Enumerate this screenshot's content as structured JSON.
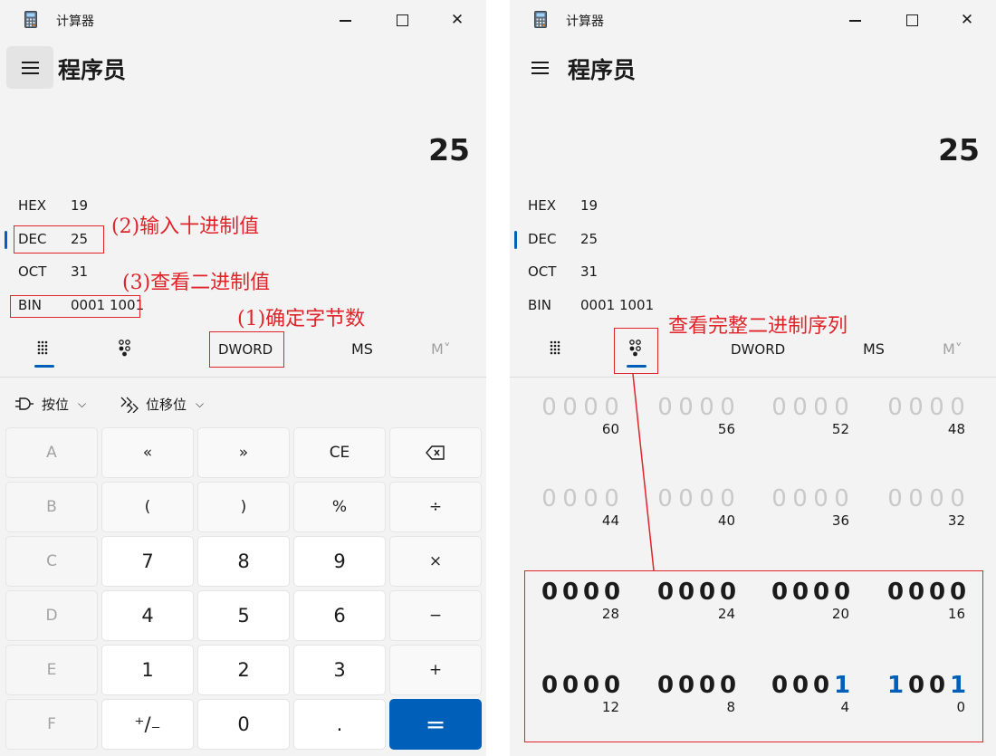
{
  "app": {
    "title": "计算器",
    "mode": "程序员",
    "display": "25",
    "radix": [
      {
        "label": "HEX",
        "value": "19"
      },
      {
        "label": "DEC",
        "value": "25"
      },
      {
        "label": "OCT",
        "value": "31"
      },
      {
        "label": "BIN",
        "value": "0001 1001"
      }
    ],
    "toolbar": {
      "word_size": "DWORD",
      "ms": "MS",
      "mr": "M˅"
    },
    "bitwise": {
      "bit_ops": "按位",
      "bit_shift": "位移位"
    },
    "keypad": [
      [
        "A",
        "«",
        "»",
        "CE",
        "backspace"
      ],
      [
        "B",
        "(",
        ")",
        "%",
        "÷"
      ],
      [
        "C",
        "7",
        "8",
        "9",
        "×"
      ],
      [
        "D",
        "4",
        "5",
        "6",
        "−"
      ],
      [
        "E",
        "1",
        "2",
        "3",
        "+"
      ],
      [
        "F",
        "⁺/₋",
        "0",
        ".",
        "="
      ]
    ],
    "bit_rows": [
      {
        "bits": [
          "0000",
          "0000",
          "0000",
          "0000"
        ],
        "positions": [
          "60",
          "56",
          "52",
          "48"
        ],
        "active": false
      },
      {
        "bits": [
          "0000",
          "0000",
          "0000",
          "0000"
        ],
        "positions": [
          "44",
          "40",
          "36",
          "32"
        ],
        "active": false
      },
      {
        "bits": [
          "0000",
          "0000",
          "0000",
          "0000"
        ],
        "positions": [
          "28",
          "24",
          "20",
          "16"
        ],
        "active": true
      },
      {
        "bits": [
          "0000",
          "0000",
          "0001",
          "1001"
        ],
        "positions": [
          "12",
          "8",
          "4",
          "0"
        ],
        "active": true
      }
    ],
    "icons": [
      "calculator-icon",
      "minimize-icon",
      "maximize-icon",
      "close-icon",
      "hamburger-menu-icon",
      "full-keypad-icon",
      "bit-toggle-keypad-icon",
      "logic-gate-icon",
      "bit-shift-icon",
      "chevron-down-icon",
      "backspace-icon"
    ]
  },
  "annotations": {
    "left_dec": "(2)输入十进制值",
    "left_bin": "(3)查看二进制值",
    "left_word": "(1)确定字节数",
    "right_bits": "查看完整二进制序列"
  },
  "colors": {
    "accent": "#005fb8",
    "annotation": "#e0242a",
    "background": "#f3f3f3"
  }
}
